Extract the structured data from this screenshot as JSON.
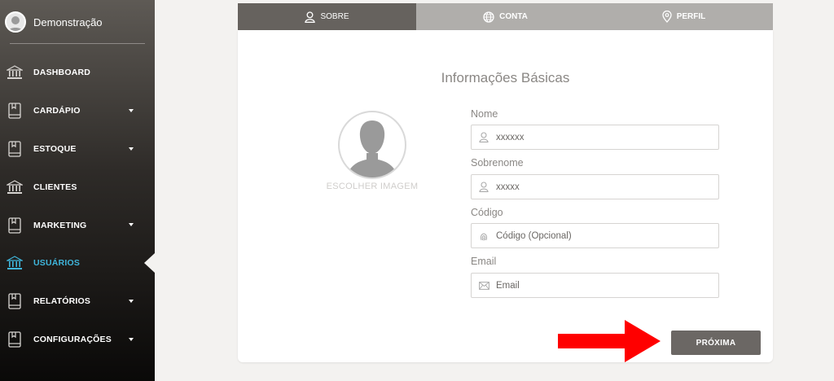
{
  "user": {
    "name": "Demonstração"
  },
  "sidebar": {
    "items": [
      {
        "label": "DASHBOARD",
        "icon": "bank-icon",
        "has_caret": false
      },
      {
        "label": "CARDÁPIO",
        "icon": "book-icon",
        "has_caret": true
      },
      {
        "label": "ESTOQUE",
        "icon": "book-icon",
        "has_caret": true
      },
      {
        "label": "CLIENTES",
        "icon": "bank-icon",
        "has_caret": false
      },
      {
        "label": "MARKETING",
        "icon": "book-icon",
        "has_caret": true
      },
      {
        "label": "USUÁRIOS",
        "icon": "bank-icon",
        "has_caret": false,
        "active": true
      },
      {
        "label": "RELATÓRIOS",
        "icon": "book-icon",
        "has_caret": true
      },
      {
        "label": "CONFIGURAÇÕES",
        "icon": "book-icon",
        "has_caret": true
      }
    ],
    "active_color": "#3fb6dc"
  },
  "tabs": [
    {
      "label": "SOBRE",
      "icon": "user-icon",
      "active": true
    },
    {
      "label": "CONTA",
      "icon": "globe-icon",
      "active": false
    },
    {
      "label": "PERFIL",
      "icon": "location-pin-icon",
      "active": false
    }
  ],
  "form": {
    "title": "Informações Básicas",
    "photo_label": "ESCOLHER IMAGEM",
    "fields": {
      "nome": {
        "label": "Nome",
        "value": "xxxxxx",
        "icon": "user-icon"
      },
      "sobrenome": {
        "label": "Sobrenome",
        "value": "xxxxx",
        "icon": "user-icon"
      },
      "codigo": {
        "label": "Código",
        "placeholder": "Código (Opcional)",
        "icon": "fingerprint-icon"
      },
      "email": {
        "label": "Email",
        "placeholder": "Email",
        "icon": "envelope-icon"
      }
    },
    "next_label": "PRÓXIMA"
  },
  "annotation": {
    "color": "#ff0000",
    "icon": "red-arrow"
  }
}
